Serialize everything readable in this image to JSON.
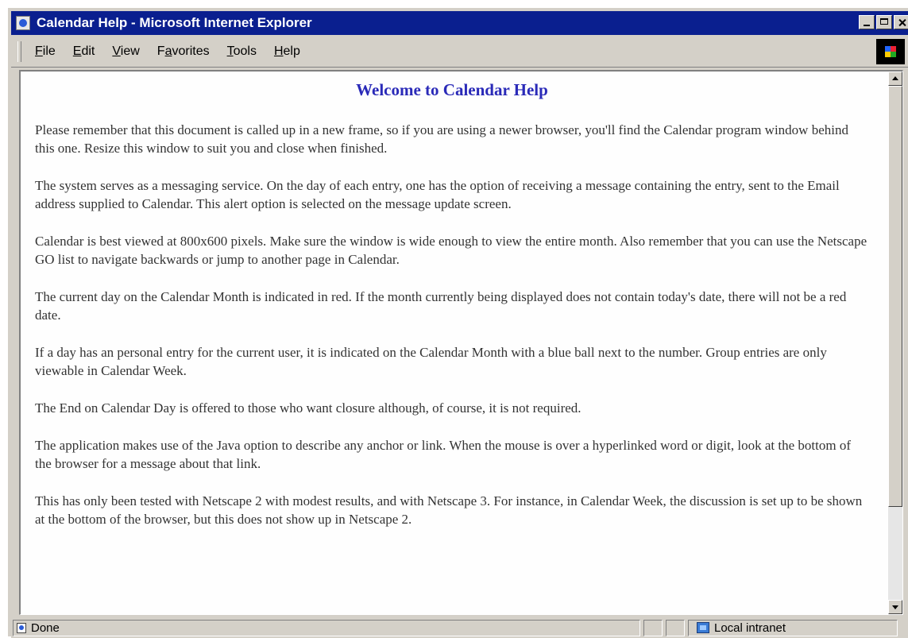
{
  "window": {
    "title": "Calendar Help - Microsoft Internet Explorer"
  },
  "menu": {
    "items": [
      {
        "label": "File",
        "accel": "F",
        "rest": "ile"
      },
      {
        "label": "Edit",
        "accel": "E",
        "rest": "dit"
      },
      {
        "label": "View",
        "accel": "V",
        "rest": "iew"
      },
      {
        "label": "Favorites",
        "pre": "F",
        "accel": "a",
        "rest": "vorites"
      },
      {
        "label": "Tools",
        "accel": "T",
        "rest": "ools"
      },
      {
        "label": "Help",
        "accel": "H",
        "rest": "elp"
      }
    ]
  },
  "document": {
    "heading": "Welcome to Calendar Help",
    "paragraphs": [
      "Please remember that this document is called up in a new frame, so if you are using a newer browser, you'll find the Calendar program window behind this one. Resize this window to suit you and close when finished.",
      "The system serves as a messaging service. On the day of each entry, one has the option of receiving a message containing the entry, sent to the Email address supplied to Calendar. This alert option is selected on the message update screen.",
      "Calendar is best viewed at 800x600 pixels. Make sure the window is wide enough to view the entire month. Also remember that you can use the Netscape GO list to navigate backwards or jump to another page in Calendar.",
      "The current day on the Calendar Month is indicated in red. If the month currently being displayed does not contain today's date, there will not be a red date.",
      "If a day has an personal entry for the current user, it is indicated on the Calendar Month with a blue ball next to the number. Group entries are only viewable in Calendar Week.",
      "The End on Calendar Day is offered to those who want closure although, of course, it is not required.",
      "The application makes use of the Java option to describe any anchor or link. When the mouse is over a hyperlinked word or digit, look at the bottom of the browser for a message about that link.",
      "This has only been tested with Netscape 2 with modest results, and with Netscape 3. For instance, in Calendar Week, the discussion is set up to be shown at the bottom of the browser, but this does not show up in Netscape 2."
    ]
  },
  "status": {
    "text": "Done",
    "zone": "Local intranet"
  },
  "icons": {
    "title": "ie-page-icon",
    "throbber": "windows-logo-icon",
    "status": "page-done-icon",
    "zone": "local-intranet-icon"
  },
  "colors": {
    "titlebar": "#0a1f8f",
    "heading": "#2a2ab8",
    "chrome": "#d4d0c8"
  }
}
